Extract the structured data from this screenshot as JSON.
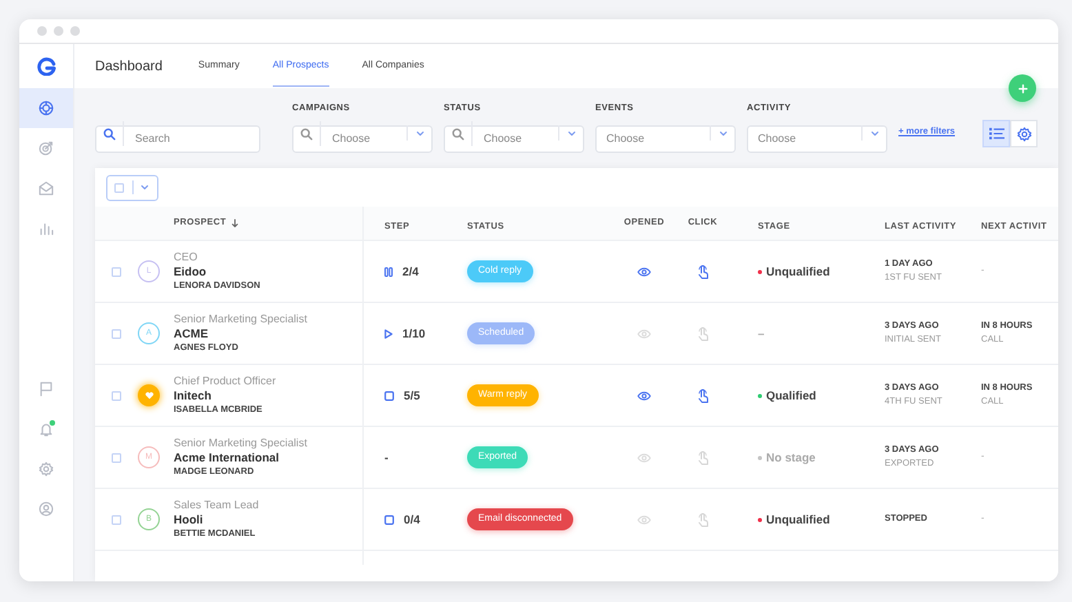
{
  "sidebar": {
    "items": [
      {
        "kind": "dashboard",
        "selected": true,
        "badge": false
      },
      {
        "kind": "target",
        "selected": false,
        "badge": false
      },
      {
        "kind": "mail",
        "selected": false,
        "badge": false
      },
      {
        "kind": "chart",
        "selected": false,
        "badge": false
      },
      {
        "kind": "flag",
        "selected": false,
        "badge": false
      },
      {
        "kind": "bell",
        "selected": false,
        "badge": true
      },
      {
        "kind": "settings",
        "selected": false,
        "badge": false
      },
      {
        "kind": "user",
        "selected": false,
        "badge": false
      }
    ]
  },
  "header": {
    "title": "Dashboard",
    "tabs": [
      {
        "label": "Summary",
        "selected": false
      },
      {
        "label": "All Prospects",
        "selected": true
      },
      {
        "label": "All Companies",
        "selected": false
      }
    ]
  },
  "filters": {
    "search": {
      "placeholder": "Search"
    },
    "dropdowns": [
      {
        "label": "CAMPAIGNS",
        "placeholder": "Choose",
        "searchable": true
      },
      {
        "label": "STATUS",
        "placeholder": "Choose",
        "searchable": true
      },
      {
        "label": "EVENTS",
        "placeholder": "Choose",
        "searchable": false
      },
      {
        "label": "ACTIVITY",
        "placeholder": "Choose",
        "searchable": false
      }
    ],
    "more_filters": "+ more filters",
    "view_buttons": [
      {
        "kind": "list",
        "selected": true
      },
      {
        "kind": "settings",
        "selected": false
      }
    ]
  },
  "table": {
    "select_all": {
      "checked": false
    },
    "columns": [
      {
        "label": "PROSPECT",
        "sorted": true
      },
      {
        "label": "STEP",
        "sorted": false
      },
      {
        "label": "STATUS",
        "sorted": false
      },
      {
        "label": "OPENED",
        "sorted": false
      },
      {
        "label": "CLICK",
        "sorted": false
      },
      {
        "label": "STAGE",
        "sorted": false
      },
      {
        "label": "LAST ACTIVITY",
        "sorted": false
      },
      {
        "label": "NEXT ACTIVIT",
        "sorted": false
      }
    ],
    "rows": [
      {
        "checked": false,
        "avatar": {
          "kind": "letter",
          "letter": "L",
          "color": "#c6c0f2"
        },
        "title": "CEO",
        "company": "Eidoo",
        "name": "LENORA DAVIDSON",
        "step": {
          "kind": "pause",
          "text": "2/4"
        },
        "status": {
          "label": "Cold reply",
          "color": "#4ccaf8"
        },
        "opened": true,
        "clicked": true,
        "stage": {
          "label": "Unqualified",
          "color": "#f0304a",
          "muted": false
        },
        "last_activity": [
          "1 DAY AGO",
          "1ST FU SENT"
        ],
        "next_activity": [
          "-"
        ]
      },
      {
        "checked": false,
        "avatar": {
          "kind": "letter",
          "letter": "A",
          "color": "#7fd6f6"
        },
        "title": "Senior Marketing Specialist",
        "company": "ACME",
        "name": "AGNES FLOYD",
        "step": {
          "kind": "play",
          "text": "1/10"
        },
        "status": {
          "label": "Scheduled",
          "color": "#9cb8f8"
        },
        "opened": false,
        "clicked": false,
        "stage": {
          "label": "–",
          "muted": true
        },
        "last_activity": [
          "3 DAYS AGO",
          "INITIAL SENT"
        ],
        "next_activity": [
          "IN 8 HOURS",
          "CALL"
        ]
      },
      {
        "checked": false,
        "avatar": {
          "kind": "heart",
          "color": "#ffb300"
        },
        "title": "Chief Product Officer",
        "company": "Initech",
        "name": "ISABELLA MCBRIDE",
        "step": {
          "kind": "stop",
          "text": "5/5"
        },
        "status": {
          "label": "Warm reply",
          "color": "#ffb300"
        },
        "opened": true,
        "clicked": true,
        "stage": {
          "label": "Qualified",
          "color": "#2ecc71",
          "muted": false
        },
        "last_activity": [
          "3 DAYS AGO",
          "4TH FU SENT"
        ],
        "next_activity": [
          "IN 8 HOURS",
          "CALL"
        ]
      },
      {
        "checked": false,
        "avatar": {
          "kind": "letter",
          "letter": "M",
          "color": "#f6bcbc"
        },
        "title": "Senior Marketing Specialist",
        "company": "Acme International",
        "name": "MADGE LEONARD",
        "step": {
          "kind": "none",
          "text": "-"
        },
        "status": {
          "label": "Exported",
          "color": "#3ddbb7"
        },
        "opened": false,
        "clicked": false,
        "stage": {
          "label": "No stage",
          "color": "#c4c4c4",
          "muted": true
        },
        "last_activity": [
          "3 DAYS AGO",
          "EXPORTED"
        ],
        "next_activity": [
          "-"
        ]
      },
      {
        "checked": false,
        "avatar": {
          "kind": "letter",
          "letter": "B",
          "color": "#94d394"
        },
        "title": "Sales Team Lead",
        "company": "Hooli",
        "name": "BETTIE MCDANIEL",
        "step": {
          "kind": "stop",
          "text": "0/4"
        },
        "status": {
          "label": "Email disconnected",
          "color": "#e5484d"
        },
        "opened": false,
        "clicked": false,
        "stage": {
          "label": "Unqualified",
          "color": "#f0304a",
          "muted": false
        },
        "last_activity": [
          "STOPPED"
        ],
        "next_activity": [
          "-"
        ]
      }
    ]
  }
}
